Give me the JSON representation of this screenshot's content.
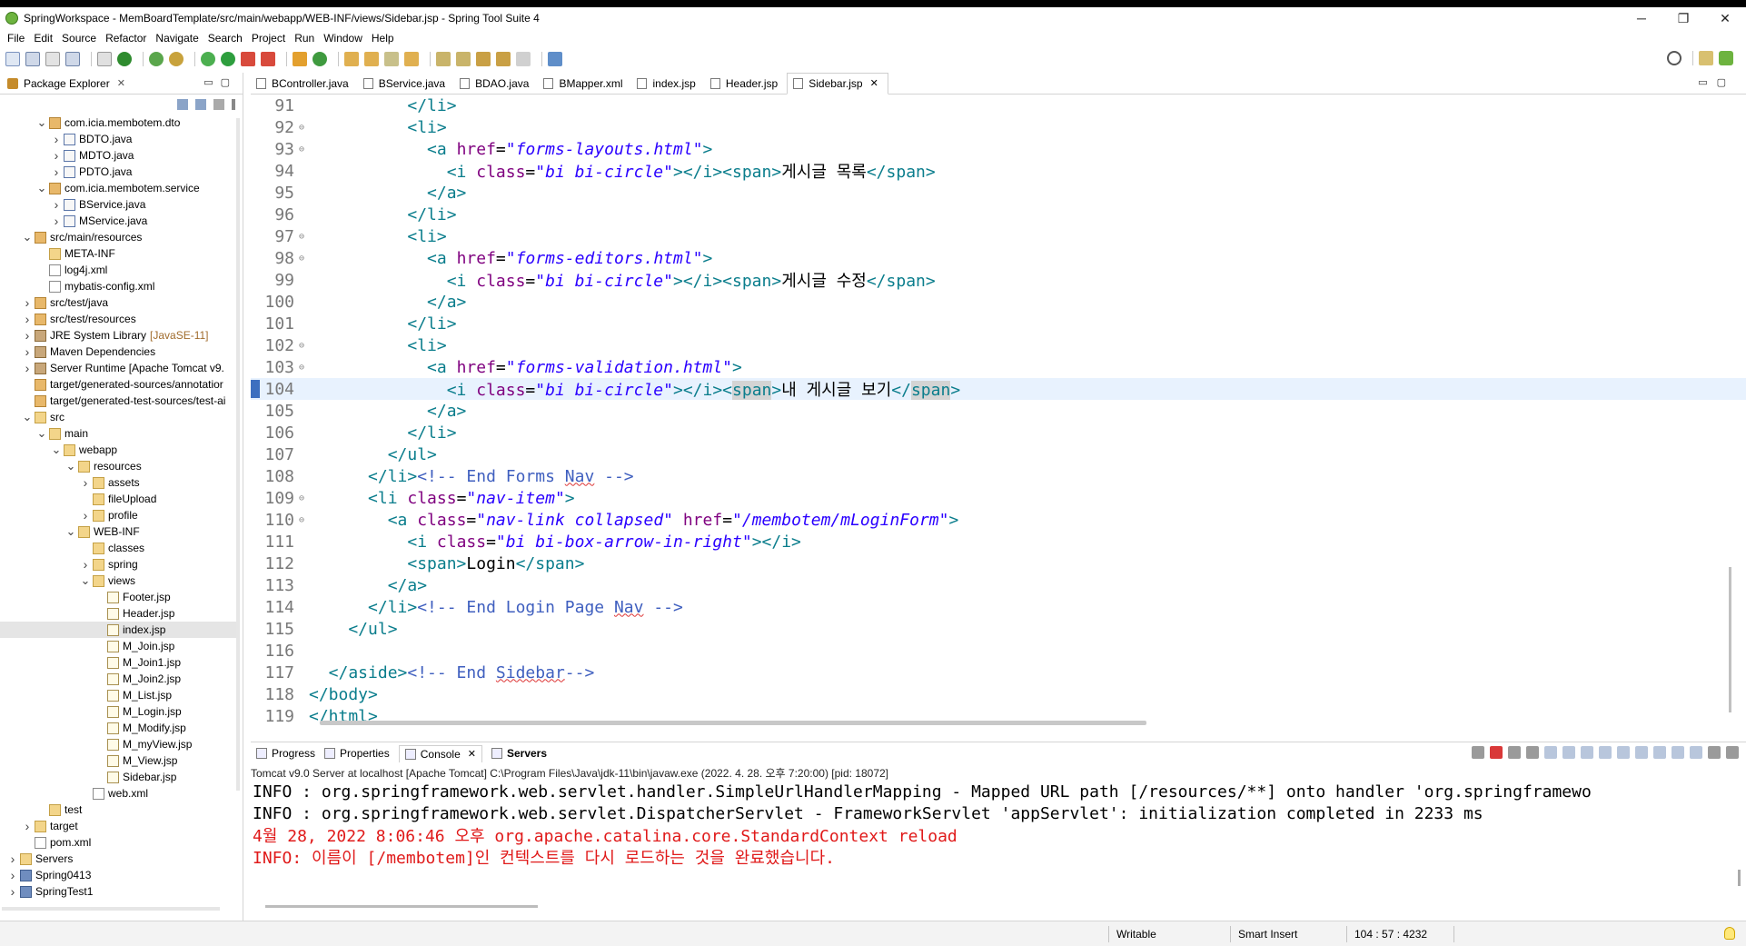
{
  "window": {
    "title": "SpringWorkspace - MemBoardTemplate/src/main/webapp/WEB-INF/views/Sidebar.jsp - Spring Tool Suite 4",
    "minimize": "─",
    "maximize": "❐",
    "close": "✕"
  },
  "menu": [
    "File",
    "Edit",
    "Source",
    "Refactor",
    "Navigate",
    "Search",
    "Project",
    "Run",
    "Window",
    "Help"
  ],
  "package_explorer": {
    "title": "Package Explorer",
    "tree": [
      {
        "label": "com.icia.membotem.dto",
        "indent": 2,
        "arrow": "v",
        "icon": "pkg"
      },
      {
        "label": "BDTO.java",
        "indent": 3,
        "arrow": ">",
        "icon": "java"
      },
      {
        "label": "MDTO.java",
        "indent": 3,
        "arrow": ">",
        "icon": "java"
      },
      {
        "label": "PDTO.java",
        "indent": 3,
        "arrow": ">",
        "icon": "java"
      },
      {
        "label": "com.icia.membotem.service",
        "indent": 2,
        "arrow": "v",
        "icon": "pkg"
      },
      {
        "label": "BService.java",
        "indent": 3,
        "arrow": ">",
        "icon": "java"
      },
      {
        "label": "MService.java",
        "indent": 3,
        "arrow": ">",
        "icon": "java"
      },
      {
        "label": "src/main/resources",
        "indent": 1,
        "arrow": "v",
        "icon": "pkg"
      },
      {
        "label": "META-INF",
        "indent": 2,
        "arrow": "",
        "icon": "folder"
      },
      {
        "label": "log4j.xml",
        "indent": 2,
        "arrow": "",
        "icon": "xml"
      },
      {
        "label": "mybatis-config.xml",
        "indent": 2,
        "arrow": "",
        "icon": "xml"
      },
      {
        "label": "src/test/java",
        "indent": 1,
        "arrow": ">",
        "icon": "pkg"
      },
      {
        "label": "src/test/resources",
        "indent": 1,
        "arrow": ">",
        "icon": "pkg"
      },
      {
        "label": "JRE System Library",
        "suffix": "[JavaSE-11]",
        "indent": 1,
        "arrow": ">",
        "icon": "lib"
      },
      {
        "label": "Maven Dependencies",
        "indent": 1,
        "arrow": ">",
        "icon": "lib"
      },
      {
        "label": "Server Runtime [Apache Tomcat v9.",
        "indent": 1,
        "arrow": ">",
        "icon": "lib"
      },
      {
        "label": "target/generated-sources/annotatior",
        "indent": 1,
        "arrow": "",
        "icon": "pkg"
      },
      {
        "label": "target/generated-test-sources/test-ai",
        "indent": 1,
        "arrow": "",
        "icon": "pkg"
      },
      {
        "label": "src",
        "indent": 1,
        "arrow": "v",
        "icon": "folder"
      },
      {
        "label": "main",
        "indent": 2,
        "arrow": "v",
        "icon": "folder"
      },
      {
        "label": "webapp",
        "indent": 3,
        "arrow": "v",
        "icon": "folder"
      },
      {
        "label": "resources",
        "indent": 4,
        "arrow": "v",
        "icon": "folder"
      },
      {
        "label": "assets",
        "indent": 5,
        "arrow": ">",
        "icon": "folder"
      },
      {
        "label": "fileUpload",
        "indent": 5,
        "arrow": "",
        "icon": "folder"
      },
      {
        "label": "profile",
        "indent": 5,
        "arrow": ">",
        "icon": "folder"
      },
      {
        "label": "WEB-INF",
        "indent": 4,
        "arrow": "v",
        "icon": "folder"
      },
      {
        "label": "classes",
        "indent": 5,
        "arrow": "",
        "icon": "folder"
      },
      {
        "label": "spring",
        "indent": 5,
        "arrow": ">",
        "icon": "folder"
      },
      {
        "label": "views",
        "indent": 5,
        "arrow": "v",
        "icon": "folder"
      },
      {
        "label": "Footer.jsp",
        "indent": 6,
        "arrow": "",
        "icon": "jsp"
      },
      {
        "label": "Header.jsp",
        "indent": 6,
        "arrow": "",
        "icon": "jsp"
      },
      {
        "label": "index.jsp",
        "indent": 6,
        "arrow": "",
        "icon": "jsp",
        "selected": true
      },
      {
        "label": "M_Join.jsp",
        "indent": 6,
        "arrow": "",
        "icon": "jsp"
      },
      {
        "label": "M_Join1.jsp",
        "indent": 6,
        "arrow": "",
        "icon": "jsp"
      },
      {
        "label": "M_Join2.jsp",
        "indent": 6,
        "arrow": "",
        "icon": "jsp"
      },
      {
        "label": "M_List.jsp",
        "indent": 6,
        "arrow": "",
        "icon": "jsp"
      },
      {
        "label": "M_Login.jsp",
        "indent": 6,
        "arrow": "",
        "icon": "jsp"
      },
      {
        "label": "M_Modify.jsp",
        "indent": 6,
        "arrow": "",
        "icon": "jsp"
      },
      {
        "label": "M_myView.jsp",
        "indent": 6,
        "arrow": "",
        "icon": "jsp"
      },
      {
        "label": "M_View.jsp",
        "indent": 6,
        "arrow": "",
        "icon": "jsp"
      },
      {
        "label": "Sidebar.jsp",
        "indent": 6,
        "arrow": "",
        "icon": "jsp"
      },
      {
        "label": "web.xml",
        "indent": 5,
        "arrow": "",
        "icon": "xml"
      },
      {
        "label": "test",
        "indent": 2,
        "arrow": "",
        "icon": "folder"
      },
      {
        "label": "target",
        "indent": 1,
        "arrow": ">",
        "icon": "folder"
      },
      {
        "label": "pom.xml",
        "indent": 1,
        "arrow": "",
        "icon": "xml"
      },
      {
        "label": "Servers",
        "indent": 0,
        "arrow": ">",
        "icon": "folder"
      },
      {
        "label": "Spring0413",
        "indent": 0,
        "arrow": ">",
        "icon": "proj"
      },
      {
        "label": "SpringTest1",
        "indent": 0,
        "arrow": ">",
        "icon": "proj"
      }
    ]
  },
  "editor_tabs": [
    {
      "label": "BController.java"
    },
    {
      "label": "BService.java"
    },
    {
      "label": "BDAO.java"
    },
    {
      "label": "BMapper.xml"
    },
    {
      "label": "index.jsp"
    },
    {
      "label": "Header.jsp"
    },
    {
      "label": "Sidebar.jsp",
      "active": true
    }
  ],
  "code_lines": [
    {
      "num": "91",
      "fold": "",
      "cur": false,
      "segs": [
        [
          "tag",
          "          </li>"
        ]
      ]
    },
    {
      "num": "92",
      "fold": "⊖",
      "cur": false,
      "segs": [
        [
          "tag",
          "          <li>"
        ]
      ]
    },
    {
      "num": "93",
      "fold": "⊖",
      "cur": false,
      "segs": [
        [
          "tag",
          "            <a "
        ],
        [
          "attr",
          "href"
        ],
        [
          "txt",
          "="
        ],
        [
          "val",
          "\"forms-layouts.html\""
        ],
        [
          "tag",
          ">"
        ]
      ]
    },
    {
      "num": "94",
      "fold": "",
      "cur": false,
      "segs": [
        [
          "tag",
          "              <i "
        ],
        [
          "attr",
          "class"
        ],
        [
          "txt",
          "="
        ],
        [
          "val",
          "\"bi bi-circle\""
        ],
        [
          "tag",
          "></i><span>"
        ],
        [
          "txt",
          "게시글 목록"
        ],
        [
          "tag",
          "</span>"
        ]
      ]
    },
    {
      "num": "95",
      "fold": "",
      "cur": false,
      "segs": [
        [
          "tag",
          "            </a>"
        ]
      ]
    },
    {
      "num": "96",
      "fold": "",
      "cur": false,
      "segs": [
        [
          "tag",
          "          </li>"
        ]
      ]
    },
    {
      "num": "97",
      "fold": "⊖",
      "cur": false,
      "segs": [
        [
          "tag",
          "          <li>"
        ]
      ]
    },
    {
      "num": "98",
      "fold": "⊖",
      "cur": false,
      "segs": [
        [
          "tag",
          "            <a "
        ],
        [
          "attr",
          "href"
        ],
        [
          "txt",
          "="
        ],
        [
          "val",
          "\"forms-editors.html\""
        ],
        [
          "tag",
          ">"
        ]
      ]
    },
    {
      "num": "99",
      "fold": "",
      "cur": false,
      "segs": [
        [
          "tag",
          "              <i "
        ],
        [
          "attr",
          "class"
        ],
        [
          "txt",
          "="
        ],
        [
          "val",
          "\"bi bi-circle\""
        ],
        [
          "tag",
          "></i><span>"
        ],
        [
          "txt",
          "게시글 수정"
        ],
        [
          "tag",
          "</span>"
        ]
      ]
    },
    {
      "num": "100",
      "fold": "",
      "cur": false,
      "segs": [
        [
          "tag",
          "            </a>"
        ]
      ]
    },
    {
      "num": "101",
      "fold": "",
      "cur": false,
      "segs": [
        [
          "tag",
          "          </li>"
        ]
      ]
    },
    {
      "num": "102",
      "fold": "⊖",
      "cur": false,
      "segs": [
        [
          "tag",
          "          <li>"
        ]
      ]
    },
    {
      "num": "103",
      "fold": "⊖",
      "cur": false,
      "segs": [
        [
          "tag",
          "            <a "
        ],
        [
          "attr",
          "href"
        ],
        [
          "txt",
          "="
        ],
        [
          "val",
          "\"forms-validation.html\""
        ],
        [
          "tag",
          ">"
        ]
      ]
    },
    {
      "num": "104",
      "fold": "",
      "cur": true,
      "segs": [
        [
          "tag",
          "              <i "
        ],
        [
          "attr",
          "class"
        ],
        [
          "txt",
          "="
        ],
        [
          "val",
          "\"bi bi-circle\""
        ],
        [
          "tag",
          "></i><"
        ],
        [
          "taghl",
          "span"
        ],
        [
          "tag",
          ">"
        ],
        [
          "txt",
          "내 게시글 보기"
        ],
        [
          "tag",
          "</"
        ],
        [
          "taghl",
          "span"
        ],
        [
          "tag",
          ">"
        ]
      ]
    },
    {
      "num": "105",
      "fold": "",
      "cur": false,
      "segs": [
        [
          "tag",
          "            </a>"
        ]
      ]
    },
    {
      "num": "106",
      "fold": "",
      "cur": false,
      "segs": [
        [
          "tag",
          "          </li>"
        ]
      ]
    },
    {
      "num": "107",
      "fold": "",
      "cur": false,
      "segs": [
        [
          "tag",
          "        </ul>"
        ]
      ]
    },
    {
      "num": "108",
      "fold": "",
      "cur": false,
      "segs": [
        [
          "tag",
          "      </li>"
        ],
        [
          "cmt",
          "<!-- End Forms "
        ],
        [
          "cmtsq",
          "Nav"
        ],
        [
          "cmt",
          " -->"
        ]
      ]
    },
    {
      "num": "109",
      "fold": "⊖",
      "cur": false,
      "segs": [
        [
          "tag",
          "      <li "
        ],
        [
          "attr",
          "class"
        ],
        [
          "txt",
          "="
        ],
        [
          "val",
          "\"nav-item\""
        ],
        [
          "tag",
          ">"
        ]
      ]
    },
    {
      "num": "110",
      "fold": "⊖",
      "cur": false,
      "segs": [
        [
          "tag",
          "        <a "
        ],
        [
          "attr",
          "class"
        ],
        [
          "txt",
          "="
        ],
        [
          "val",
          "\"nav-link collapsed\""
        ],
        [
          "txt",
          " "
        ],
        [
          "attr",
          "href"
        ],
        [
          "txt",
          "="
        ],
        [
          "val",
          "\"/membotem/mLoginForm\""
        ],
        [
          "tag",
          ">"
        ]
      ]
    },
    {
      "num": "111",
      "fold": "",
      "cur": false,
      "segs": [
        [
          "tag",
          "          <i "
        ],
        [
          "attr",
          "class"
        ],
        [
          "txt",
          "="
        ],
        [
          "val",
          "\"bi bi-box-arrow-in-right\""
        ],
        [
          "tag",
          "></i>"
        ]
      ]
    },
    {
      "num": "112",
      "fold": "",
      "cur": false,
      "segs": [
        [
          "tag",
          "          <span>"
        ],
        [
          "txt",
          "Login"
        ],
        [
          "tag",
          "</span>"
        ]
      ]
    },
    {
      "num": "113",
      "fold": "",
      "cur": false,
      "segs": [
        [
          "tag",
          "        </a>"
        ]
      ]
    },
    {
      "num": "114",
      "fold": "",
      "cur": false,
      "segs": [
        [
          "tag",
          "      </li>"
        ],
        [
          "cmt",
          "<!-- End Login Page "
        ],
        [
          "cmtsq",
          "Nav"
        ],
        [
          "cmt",
          " -->"
        ]
      ]
    },
    {
      "num": "115",
      "fold": "",
      "cur": false,
      "segs": [
        [
          "tag",
          "    </ul>"
        ]
      ]
    },
    {
      "num": "116",
      "fold": "",
      "cur": false,
      "segs": [
        [
          "txt",
          ""
        ]
      ]
    },
    {
      "num": "117",
      "fold": "",
      "cur": false,
      "segs": [
        [
          "tag",
          "  </aside>"
        ],
        [
          "cmt",
          "<!-- End "
        ],
        [
          "cmtsq",
          "Sidebar"
        ],
        [
          "cmt",
          "-->"
        ]
      ]
    },
    {
      "num": "118",
      "fold": "",
      "cur": false,
      "segs": [
        [
          "tag",
          "</body>"
        ]
      ]
    },
    {
      "num": "119",
      "fold": "",
      "cur": false,
      "segs": [
        [
          "tag",
          "</html>"
        ]
      ]
    }
  ],
  "console": {
    "tabs": [
      {
        "label": "Progress"
      },
      {
        "label": "Properties"
      },
      {
        "label": "Console",
        "active": true,
        "closable": true
      },
      {
        "label": "Servers",
        "bold": true
      }
    ],
    "header": "Tomcat v9.0 Server at localhost [Apache Tomcat] C:\\Program Files\\Java\\jdk-11\\bin\\javaw.exe  (2022. 4. 28. 오후 7:20:00) [pid: 18072]",
    "lines": [
      {
        "text": "INFO : org.springframework.web.servlet.handler.SimpleUrlHandlerMapping - Mapped URL path [/resources/**] onto handler 'org.springframewo",
        "red": false
      },
      {
        "text": "INFO : org.springframework.web.servlet.DispatcherServlet - FrameworkServlet 'appServlet': initialization completed in 2233 ms",
        "red": false
      },
      {
        "text": "4월 28, 2022 8:06:46 오후 org.apache.catalina.core.StandardContext reload",
        "red": true
      },
      {
        "text": "INFO: 이름이 [/membotem]인 컨텍스트를 다시 로드하는 것을 완료했습니다.",
        "red": true
      }
    ]
  },
  "status": {
    "writable": "Writable",
    "insert_mode": "Smart Insert",
    "position": "104 : 57 : 4232"
  }
}
